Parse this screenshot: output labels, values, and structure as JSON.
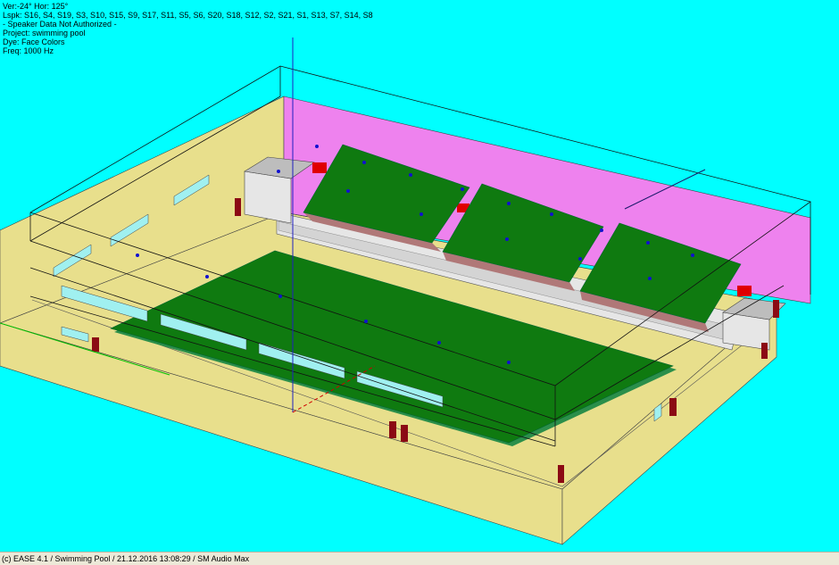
{
  "viewport": {
    "info_lines": [
      "Ver:-24°   Hor: 125°",
      "Lspk: S16, S4, S19, S3, S10, S15, S9, S17, S11, S5, S6, S20, S18, S12, S2, S21, S1, S13, S7, S14, S8",
      "- Speaker Data Not Authorized -",
      "Project: swimming pool",
      "Dye: Face Colors",
      "Freq: 1000 Hz"
    ]
  },
  "colors": {
    "background": "#00ffff",
    "floor_wall": "#e8df8c",
    "back_wall": "#ee82ee",
    "audience_area": "#0f7a10",
    "window": "#a0f0f0",
    "door": "#8b0a14",
    "speaker": "#1010d0",
    "stand": "#e6e6e6"
  },
  "statusbar": {
    "text": "(c) EASE 4.1  / Swimming Pool  / 21.12.2016 13:08:29 / SM Audio Max"
  }
}
